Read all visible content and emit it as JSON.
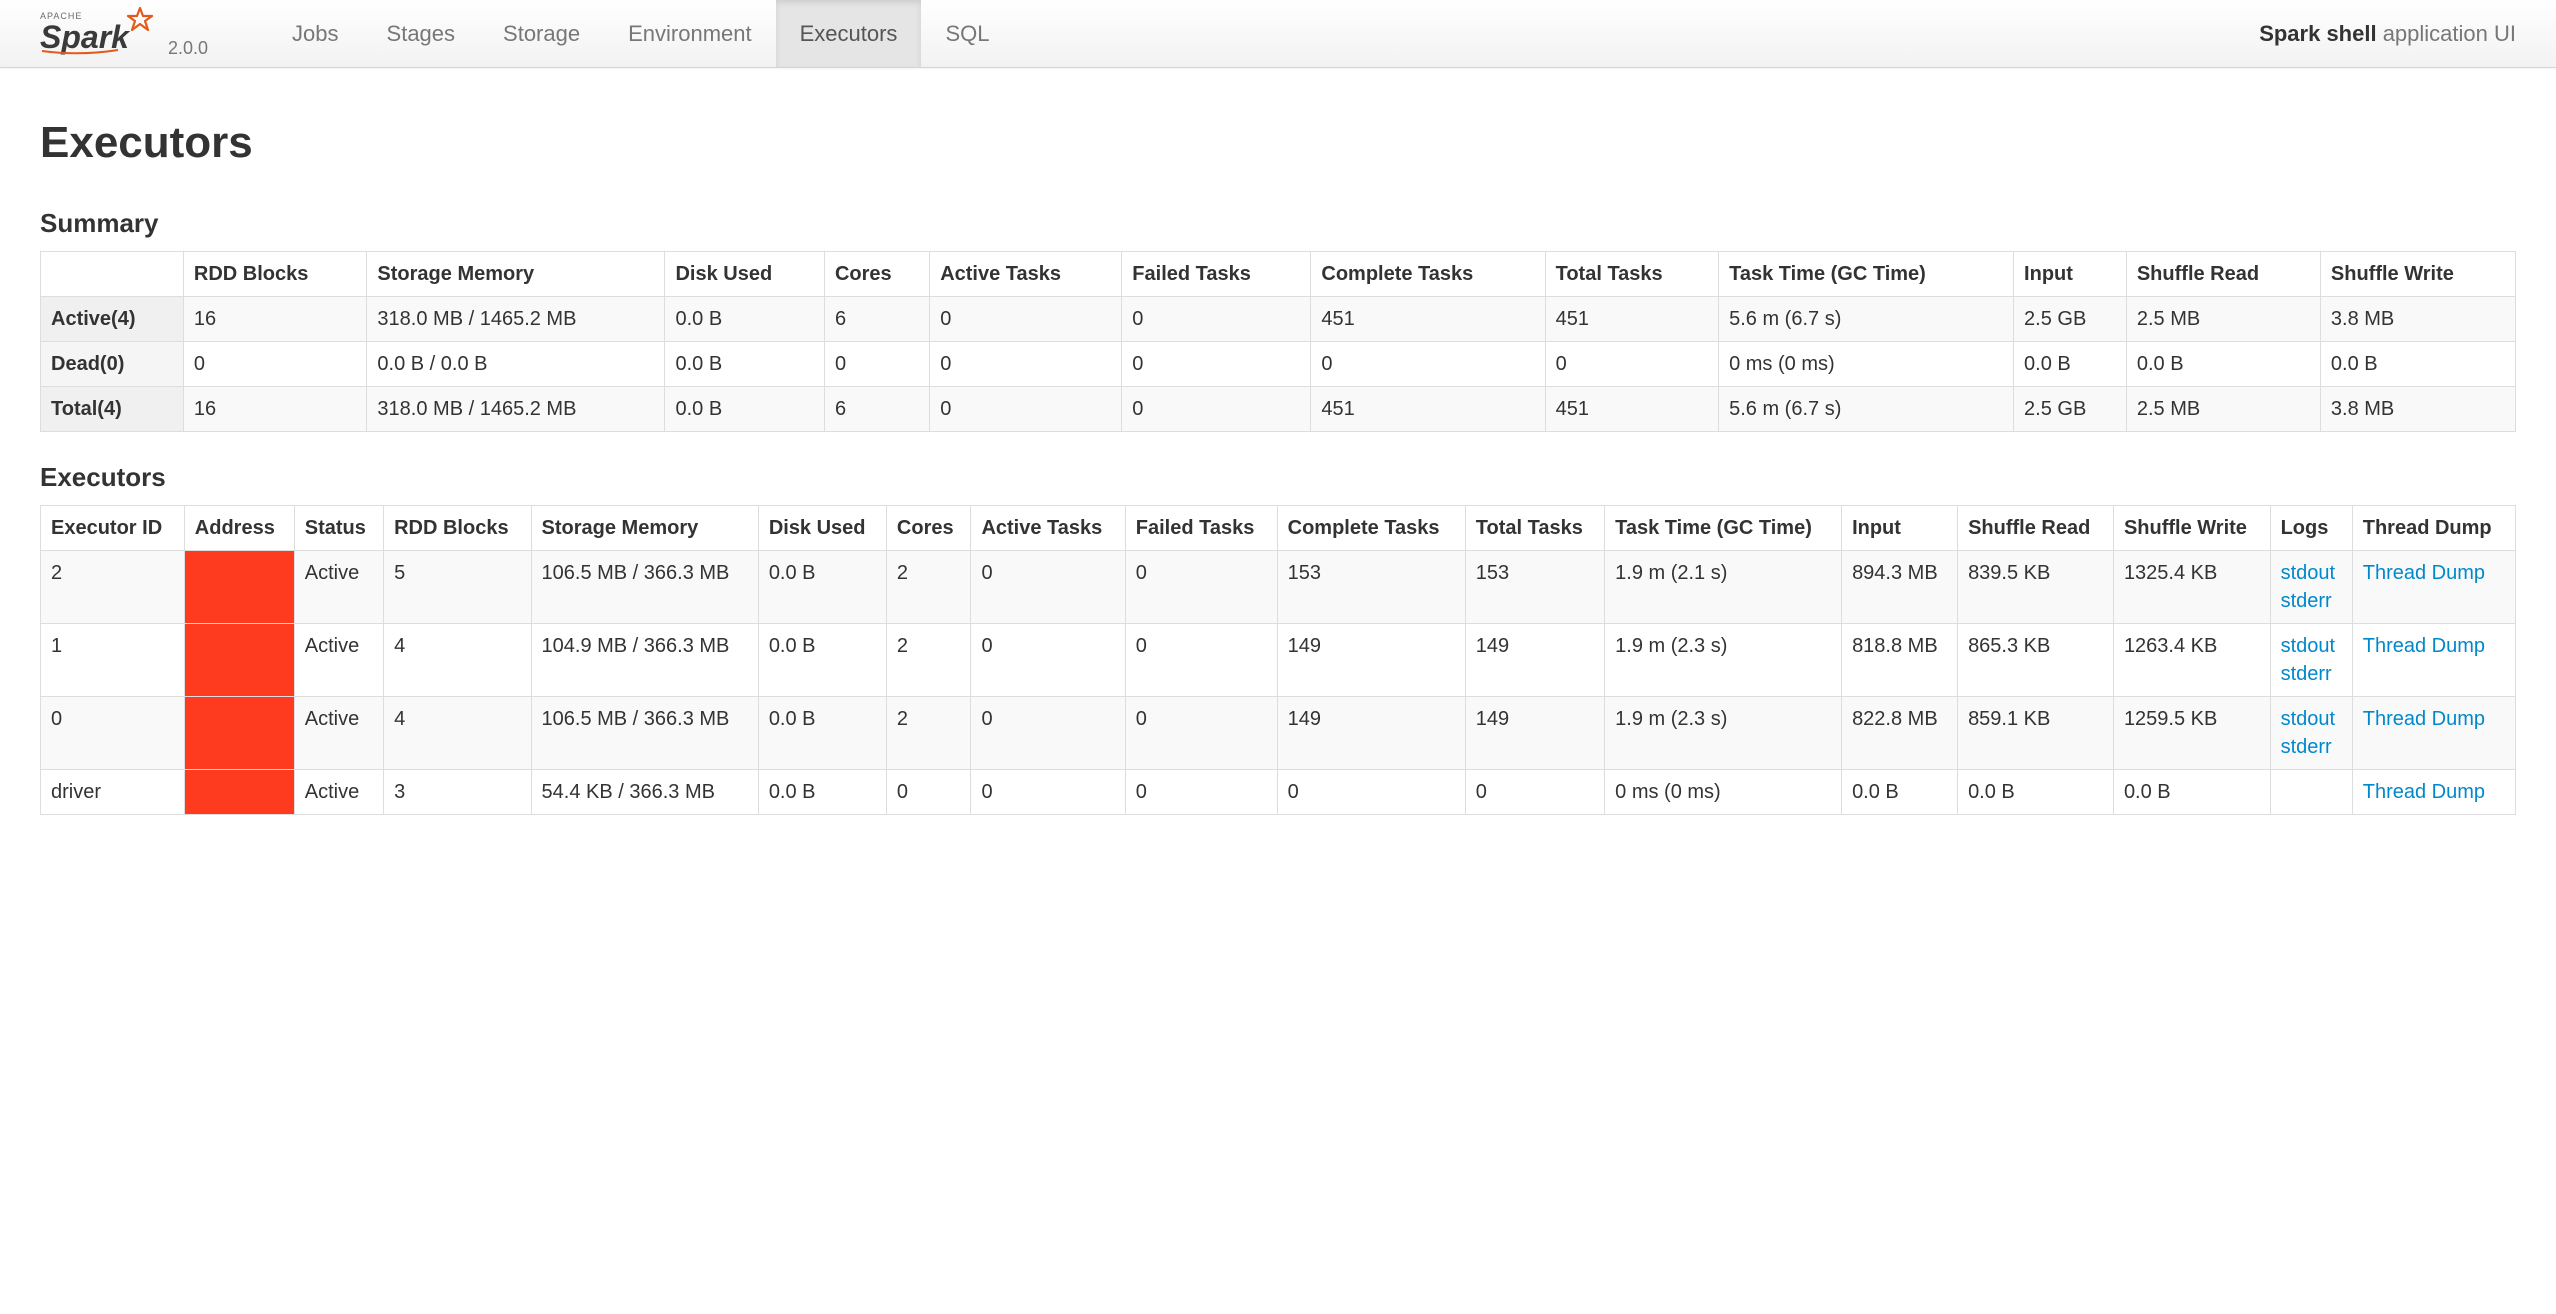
{
  "brand": {
    "version": "2.0.0"
  },
  "nav": {
    "tabs": [
      "Jobs",
      "Stages",
      "Storage",
      "Environment",
      "Executors",
      "SQL"
    ],
    "active": "Executors",
    "app_name": "Spark shell",
    "app_suffix": " application UI"
  },
  "page": {
    "title": "Executors"
  },
  "summary": {
    "heading": "Summary",
    "columns": [
      "",
      "RDD Blocks",
      "Storage Memory",
      "Disk Used",
      "Cores",
      "Active Tasks",
      "Failed Tasks",
      "Complete Tasks",
      "Total Tasks",
      "Task Time (GC Time)",
      "Input",
      "Shuffle Read",
      "Shuffle Write"
    ],
    "rows": [
      {
        "label": "Active(4)",
        "cells": [
          "16",
          "318.0 MB / 1465.2 MB",
          "0.0 B",
          "6",
          "0",
          "0",
          "451",
          "451",
          "5.6 m (6.7 s)",
          "2.5 GB",
          "2.5 MB",
          "3.8 MB"
        ]
      },
      {
        "label": "Dead(0)",
        "cells": [
          "0",
          "0.0 B / 0.0 B",
          "0.0 B",
          "0",
          "0",
          "0",
          "0",
          "0",
          "0 ms (0 ms)",
          "0.0 B",
          "0.0 B",
          "0.0 B"
        ]
      },
      {
        "label": "Total(4)",
        "cells": [
          "16",
          "318.0 MB / 1465.2 MB",
          "0.0 B",
          "6",
          "0",
          "0",
          "451",
          "451",
          "5.6 m (6.7 s)",
          "2.5 GB",
          "2.5 MB",
          "3.8 MB"
        ]
      }
    ]
  },
  "executors": {
    "heading": "Executors",
    "columns": [
      "Executor ID",
      "Address",
      "Status",
      "RDD Blocks",
      "Storage Memory",
      "Disk Used",
      "Cores",
      "Active Tasks",
      "Failed Tasks",
      "Complete Tasks",
      "Total Tasks",
      "Task Time (GC Time)",
      "Input",
      "Shuffle Read",
      "Shuffle Write",
      "Logs",
      "Thread Dump"
    ],
    "rows": [
      {
        "id": "2",
        "address_redacted": true,
        "status": "Active",
        "rdd": "5",
        "mem": "106.5 MB / 366.3 MB",
        "disk": "0.0 B",
        "cores": "2",
        "active": "0",
        "failed": "0",
        "complete": "153",
        "total": "153",
        "time": "1.9 m (2.1 s)",
        "input": "894.3 MB",
        "sread": "839.5 KB",
        "swrite": "1325.4 KB",
        "logs": [
          "stdout",
          "stderr"
        ],
        "dump": "Thread Dump"
      },
      {
        "id": "1",
        "address_redacted": true,
        "status": "Active",
        "rdd": "4",
        "mem": "104.9 MB / 366.3 MB",
        "disk": "0.0 B",
        "cores": "2",
        "active": "0",
        "failed": "0",
        "complete": "149",
        "total": "149",
        "time": "1.9 m (2.3 s)",
        "input": "818.8 MB",
        "sread": "865.3 KB",
        "swrite": "1263.4 KB",
        "logs": [
          "stdout",
          "stderr"
        ],
        "dump": "Thread Dump"
      },
      {
        "id": "0",
        "address_redacted": true,
        "status": "Active",
        "rdd": "4",
        "mem": "106.5 MB / 366.3 MB",
        "disk": "0.0 B",
        "cores": "2",
        "active": "0",
        "failed": "0",
        "complete": "149",
        "total": "149",
        "time": "1.9 m (2.3 s)",
        "input": "822.8 MB",
        "sread": "859.1 KB",
        "swrite": "1259.5 KB",
        "logs": [
          "stdout",
          "stderr"
        ],
        "dump": "Thread Dump"
      },
      {
        "id": "driver",
        "address_redacted": true,
        "status": "Active",
        "rdd": "3",
        "mem": "54.4 KB / 366.3 MB",
        "disk": "0.0 B",
        "cores": "0",
        "active": "0",
        "failed": "0",
        "complete": "0",
        "total": "0",
        "time": "0 ms (0 ms)",
        "input": "0.0 B",
        "sread": "0.0 B",
        "swrite": "0.0 B",
        "logs": [],
        "dump": "Thread Dump"
      }
    ]
  }
}
